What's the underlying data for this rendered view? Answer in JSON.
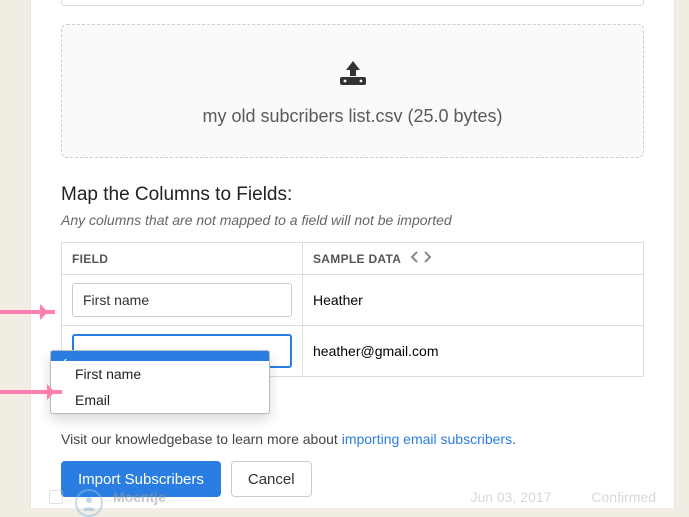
{
  "upload": {
    "filename_line": "my old subcribers list.csv (25.0 bytes)"
  },
  "mapping": {
    "title": "Map the Columns to Fields:",
    "note": "Any columns that are not mapped to a field will not be imported",
    "headers": {
      "field": "FIELD",
      "sample": "SAMPLE DATA"
    },
    "rows": [
      {
        "field_value": "First name",
        "sample": "Heather"
      },
      {
        "field_value": "",
        "sample": "heather@gmail.com"
      }
    ],
    "dropdown_options": [
      {
        "label": "",
        "selected": true
      },
      {
        "label": "First name",
        "selected": false
      },
      {
        "label": "Email",
        "selected": false
      }
    ]
  },
  "help": {
    "prefix": "Visit our knowledgebase to learn more about ",
    "link_text": "importing email subscribers",
    "suffix": "."
  },
  "buttons": {
    "import": "Import Subscribers",
    "cancel": "Cancel"
  },
  "faded_row": {
    "name": "Moentje",
    "date": "Jun 03, 2017",
    "status": "Confirmed"
  }
}
